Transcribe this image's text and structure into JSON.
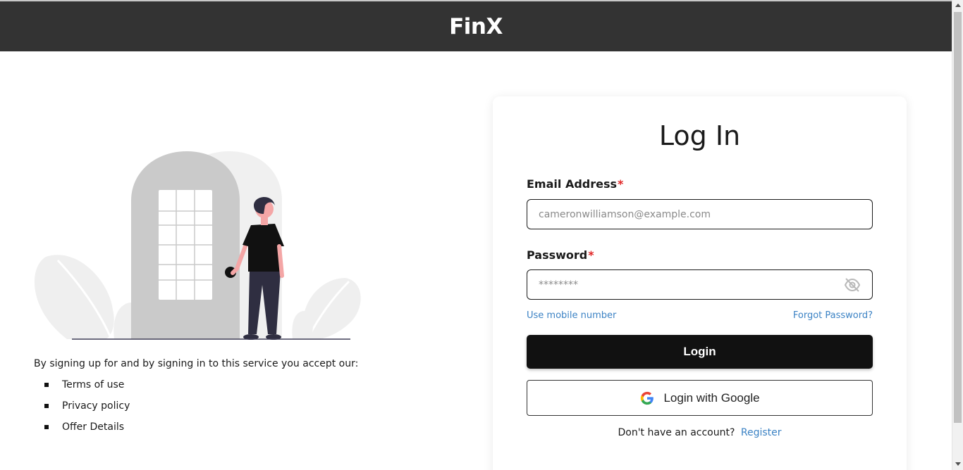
{
  "header": {
    "brand": "FinX"
  },
  "terms": {
    "intro": "By signing up for and by signing in to this service you accept our:",
    "items": [
      "Terms of use",
      "Privacy policy",
      "Offer Details"
    ]
  },
  "login_card": {
    "title": "Log In",
    "email": {
      "label": "Email Address",
      "required_mark": "*",
      "placeholder": "cameronwilliamson@example.com",
      "value": ""
    },
    "password": {
      "label": "Password",
      "required_mark": "*",
      "placeholder": "********",
      "value": ""
    },
    "use_mobile_link": "Use mobile number",
    "forgot_link": "Forgot Password?",
    "login_button": "Login",
    "google_button": "Login with Google",
    "no_account_text": "Don't have an account?",
    "register_link": "Register"
  },
  "icons": {
    "password_toggle": "eye-off-icon",
    "google": "google-g-icon"
  },
  "colors": {
    "header_bg": "#333333",
    "accent_link": "#3b82c4",
    "required": "#e02424",
    "primary_button": "#111111"
  }
}
